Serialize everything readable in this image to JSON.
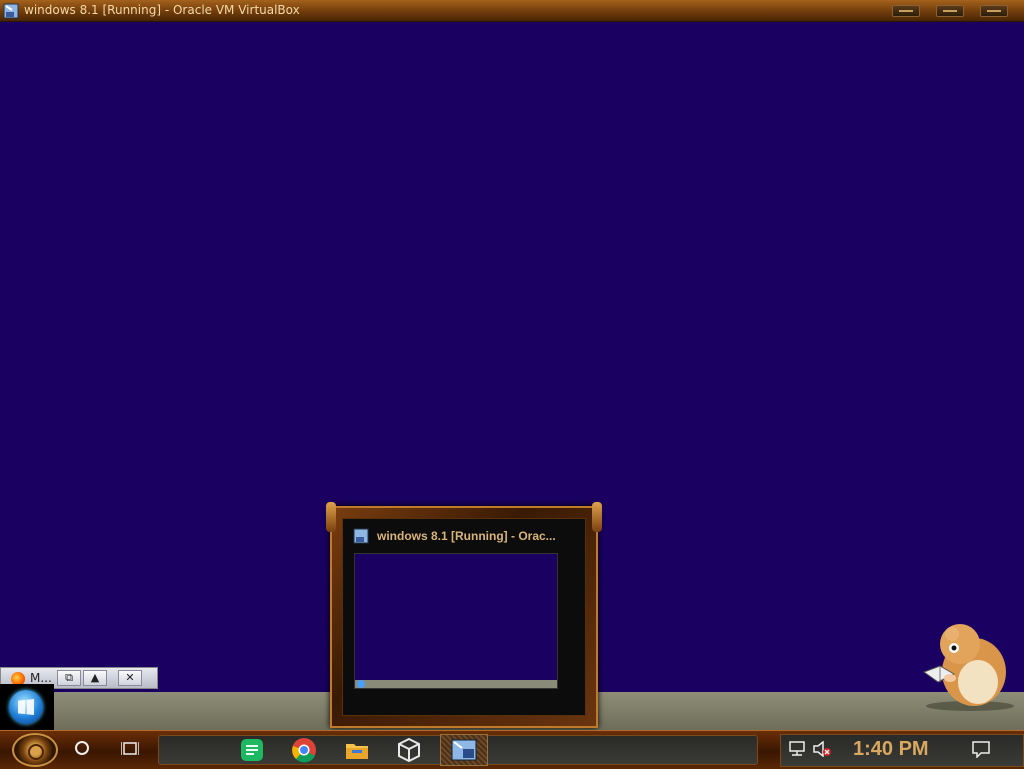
{
  "window": {
    "title": "windows 8.1 [Running] - Oracle VM VirtualBox",
    "controls": [
      "minimize-button",
      "maximize-button",
      "close-button"
    ]
  },
  "mini_window": {
    "label": "M...",
    "buttons": {
      "restore": "⧉",
      "up": "▲",
      "close": "✕"
    }
  },
  "preview": {
    "title": "windows 8.1 [Running] - Orac..."
  },
  "taskbar": {
    "apps": [
      "gear-launcher",
      "cortana-search",
      "task-view",
      "spotify",
      "chrome",
      "file-explorer",
      "virtualbox",
      "virtualbox-vm-window"
    ],
    "clock": "1:40 PM"
  },
  "colors": {
    "desktop": "#1a0060",
    "titlebar": "#7a420e",
    "accent": "#d8a860"
  }
}
